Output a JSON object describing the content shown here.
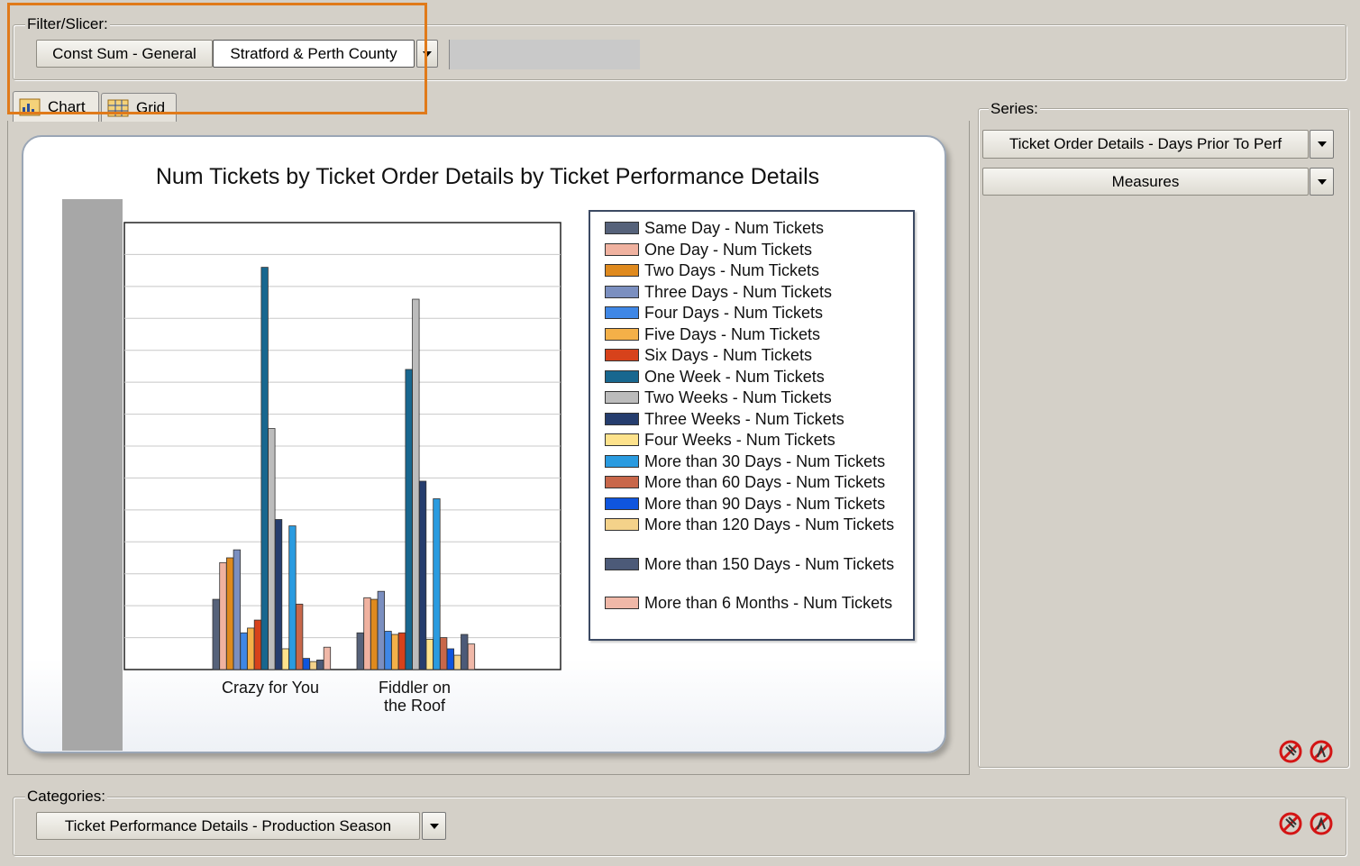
{
  "filter": {
    "legend": "Filter/Slicer:",
    "measure_label": "Const Sum - General",
    "value_label": "Stratford & Perth County"
  },
  "tabs": [
    {
      "label": "Chart",
      "icon": "chart-icon"
    },
    {
      "label": "Grid",
      "icon": "grid-icon"
    }
  ],
  "series_panel": {
    "legend": "Series:",
    "items": [
      "Ticket Order Details - Days Prior To Perf",
      "Measures"
    ]
  },
  "categories_panel": {
    "legend": "Categories:",
    "item": "Ticket Performance Details - Production Season"
  },
  "colors": {
    "highlight": "#e07a1a",
    "window_bg": "#d4d0c8"
  },
  "chart_data": {
    "type": "bar",
    "title": "Num Tickets by Ticket Order Details by Ticket Performance Details",
    "categories": [
      "Crazy for You",
      "Fiddler on the Roof"
    ],
    "ylim": [
      0,
      14
    ],
    "series": [
      {
        "name": "Same Day - Num Tickets",
        "color": "#56627a",
        "values": [
          2.2,
          1.15
        ]
      },
      {
        "name": "One Day - Num Tickets",
        "color": "#f0b2a0",
        "values": [
          3.35,
          2.25
        ]
      },
      {
        "name": "Two Days - Num Tickets",
        "color": "#df8a1e",
        "values": [
          3.5,
          2.2
        ]
      },
      {
        "name": "Three Days - Num Tickets",
        "color": "#7b8fc0",
        "values": [
          3.75,
          2.45
        ]
      },
      {
        "name": "Four Days - Num Tickets",
        "color": "#3f87e6",
        "values": [
          1.15,
          1.2
        ]
      },
      {
        "name": "Five Days - Num Tickets",
        "color": "#f4b048",
        "values": [
          1.3,
          1.1
        ]
      },
      {
        "name": "Six Days - Num Tickets",
        "color": "#d7421b",
        "values": [
          1.55,
          1.15
        ]
      },
      {
        "name": "One Week - Num Tickets",
        "color": "#18678f",
        "values": [
          12.6,
          9.4
        ]
      },
      {
        "name": "Two Weeks - Num Tickets",
        "color": "#bcbcbc",
        "values": [
          7.55,
          11.6
        ]
      },
      {
        "name": "Three Weeks - Num Tickets",
        "color": "#253d6e",
        "values": [
          4.7,
          5.9
        ]
      },
      {
        "name": "Four Weeks - Num Tickets",
        "color": "#fde28c",
        "values": [
          0.65,
          0.95
        ]
      },
      {
        "name": "More than 30 Days - Num Tickets",
        "color": "#2a9be0",
        "values": [
          4.5,
          5.35
        ]
      },
      {
        "name": "More than 60 Days - Num Tickets",
        "color": "#c8674a",
        "values": [
          2.05,
          1.0
        ]
      },
      {
        "name": "More than 90 Days - Num Tickets",
        "color": "#0f55de",
        "values": [
          0.35,
          0.65
        ]
      },
      {
        "name": "More than 120 Days - Num Tickets",
        "color": "#f4d28a",
        "values": [
          0.25,
          0.45
        ]
      },
      {
        "name": "More than 150 Days - Num Tickets",
        "color": "#4c5a78",
        "values": [
          0.3,
          1.1
        ]
      },
      {
        "name": "More than 6 Months - Num Tickets",
        "color": "#f0b8a8",
        "values": [
          0.7,
          0.8
        ]
      }
    ]
  }
}
